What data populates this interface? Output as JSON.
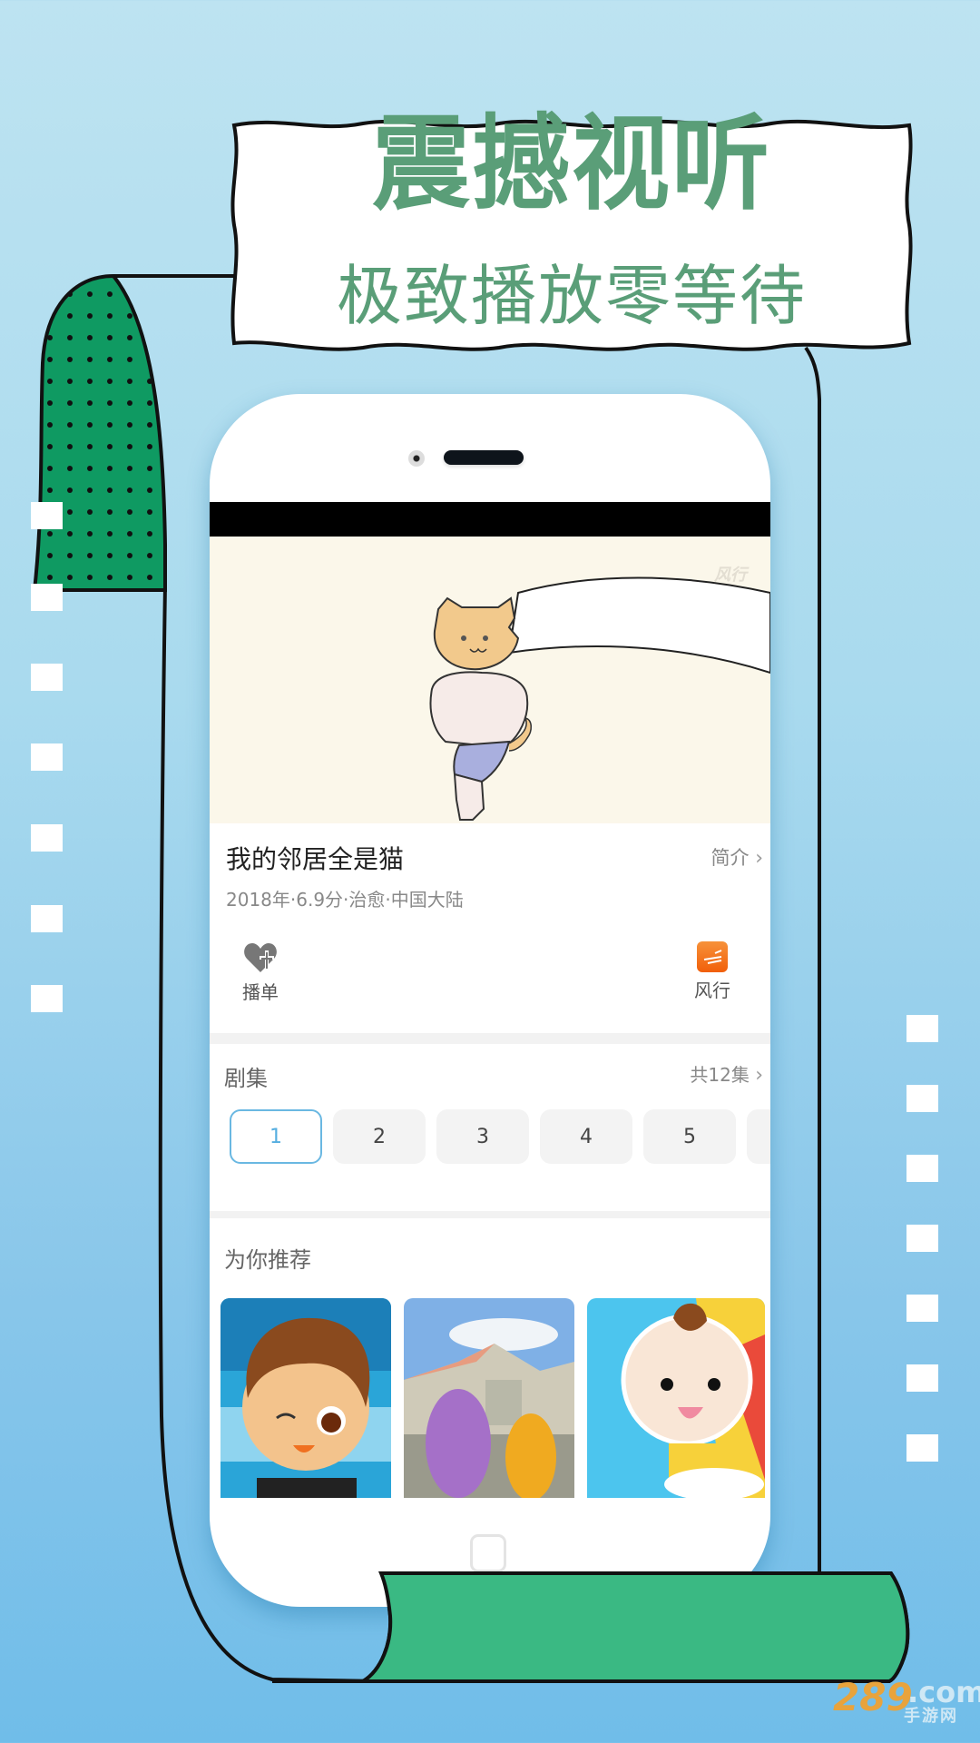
{
  "banner": {
    "headline": "震撼视听",
    "subheadline": "极致播放零等待",
    "accent_color": "#5a9e78"
  },
  "phone_screen": {
    "video": {
      "watermark": "风行",
      "description": "cartoon cat-headed muscle man"
    },
    "show": {
      "title": "我的邻居全是猫",
      "intro_link": "简介",
      "meta": "2018年·6.9分·治愈·中国大陆"
    },
    "actions": [
      {
        "label": "播单",
        "icon": "heart-plus-icon"
      },
      {
        "label": "风行",
        "icon": "fengxing-app-icon",
        "color": "#f26b12"
      }
    ],
    "episodes": {
      "label": "剧集",
      "total_link": "共12集",
      "items": [
        "1",
        "2",
        "3",
        "4",
        "5"
      ],
      "active": "1",
      "active_color": "#55aee0"
    },
    "recommend": {
      "label": "为你推荐",
      "items": [
        {
          "description": "winking cartoon boy"
        },
        {
          "description": "purple and yellow puppet monsters"
        },
        {
          "description": "cartoon baby with bottle"
        }
      ]
    }
  },
  "footer_logo": {
    "brand": "289",
    "domain": ".com",
    "sub": "手游网"
  }
}
